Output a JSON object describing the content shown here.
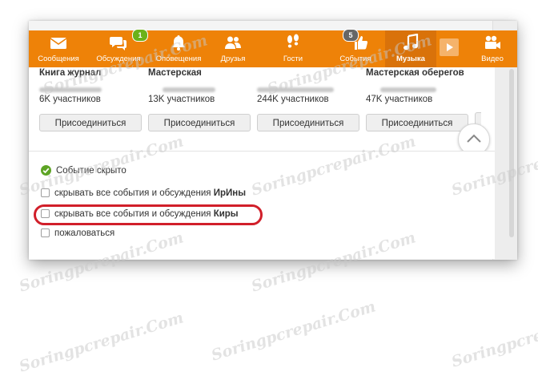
{
  "nav": {
    "items": [
      {
        "key": "messages",
        "label": "Сообщения",
        "icon": "envelope-icon"
      },
      {
        "key": "discussions",
        "label": "Обсуждения",
        "icon": "chat-bubbles-icon",
        "badge": "1"
      },
      {
        "key": "notifications",
        "label": "Оповещения",
        "icon": "bell-icon"
      },
      {
        "key": "friends",
        "label": "Друзья",
        "icon": "people-icon"
      },
      {
        "key": "guests",
        "label": "Гости",
        "icon": "footprints-icon"
      },
      {
        "key": "events",
        "label": "События",
        "icon": "thumbs-up-icon",
        "badge": "5"
      },
      {
        "key": "music",
        "label": "Музыка",
        "icon": "music-note-icon",
        "active": true
      },
      {
        "key": "video",
        "label": "Видео",
        "icon": "video-camera-icon"
      }
    ]
  },
  "groups": [
    {
      "title": "Книга журнал",
      "members": "6K участников",
      "button": "Присоединиться"
    },
    {
      "title": "Мастерская",
      "members": "13K участников",
      "button": "Присоединиться"
    },
    {
      "title": "",
      "members": "244K участников",
      "button": "Присоединиться"
    },
    {
      "title": "Мастерская оберегов",
      "members": "47K участников",
      "button": "Присоединиться"
    }
  ],
  "event": {
    "hidden_status": "Событие скрыто",
    "option_irina_prefix": "скрывать все события и обсуждения ",
    "option_irina_name": "ИрИны",
    "option_kira_prefix": "скрывать все события и обсуждения ",
    "option_kira_name": "Киры",
    "report": "пожаловаться"
  },
  "watermark": "Soringpcrepair.Com",
  "colors": {
    "accent": "#ee8208",
    "highlight": "#d11f2a",
    "success": "#5da424",
    "badge": "#6bb21a"
  }
}
